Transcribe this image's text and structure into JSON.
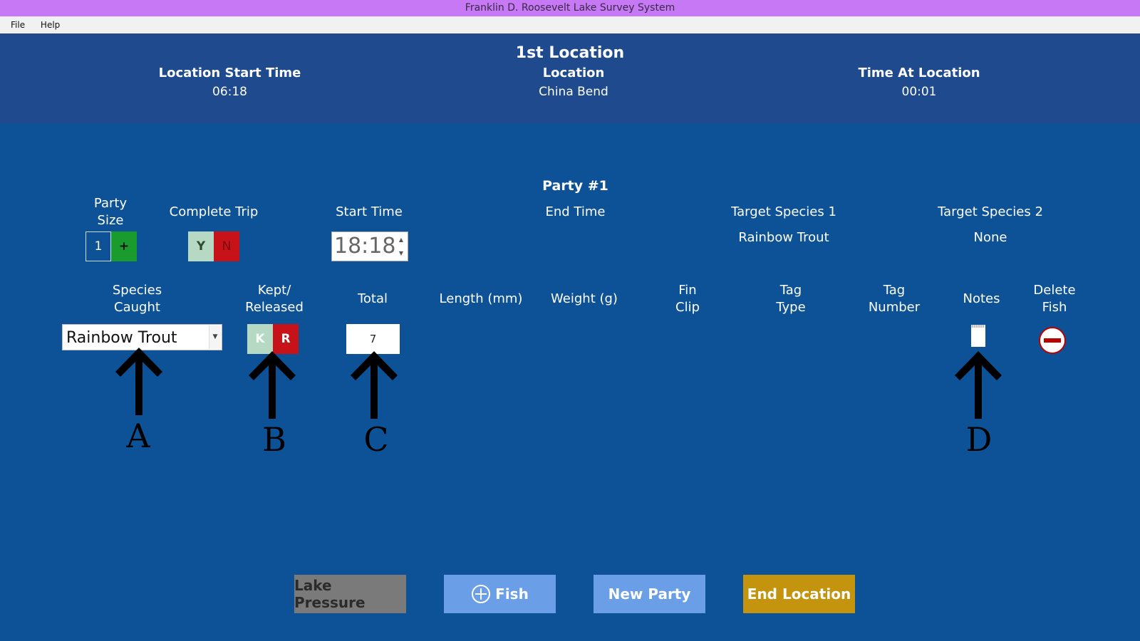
{
  "window": {
    "title": "Franklin D. Roosevelt Lake Survey System"
  },
  "menu": {
    "file": "File",
    "help": "Help"
  },
  "header": {
    "title": "1st Location",
    "start_label": "Location Start Time",
    "start_value": "06:18",
    "location_label": "Location",
    "location_value": "China Bend",
    "time_label": "Time At Location",
    "time_value": "00:01"
  },
  "party": {
    "title": "Party #1",
    "size_label_1": "Party",
    "size_label_2": "Size",
    "size_value": "1",
    "size_plus": "+",
    "complete_trip_label": "Complete Trip",
    "yes": "Y",
    "no": "N",
    "start_time_label": "Start Time",
    "start_time_value": "18:18",
    "end_time_label": "End Time",
    "target1_label": "Target Species 1",
    "target1_value": "Rainbow Trout",
    "target2_label": "Target Species 2",
    "target2_value": "None"
  },
  "fish_table": {
    "col_species_1": "Species",
    "col_species_2": "Caught",
    "col_kept_1": "Kept/",
    "col_kept_2": "Released",
    "col_total": "Total",
    "col_length": "Length (mm)",
    "col_weight": "Weight (g)",
    "col_fin_1": "Fin",
    "col_fin_2": "Clip",
    "col_tagtype_1": "Tag",
    "col_tagtype_2": "Type",
    "col_tagnum_1": "Tag",
    "col_tagnum_2": "Number",
    "col_notes": "Notes",
    "col_delete_1": "Delete",
    "col_delete_2": "Fish",
    "row": {
      "species": "Rainbow Trout",
      "kept": "K",
      "released": "R",
      "total": "7"
    }
  },
  "annotations": {
    "a": "A",
    "b": "B",
    "c": "C",
    "d": "D"
  },
  "buttons": {
    "lake_pressure": "Lake Pressure",
    "add_fish": "Fish",
    "new_party": "New Party",
    "end_location": "End Location"
  },
  "colors": {
    "background": "#0d5296",
    "header": "#1f4a8e",
    "titlebar": "#c678f5",
    "green": "#1a9b2e",
    "red": "#c8121a",
    "light_green": "#b6d9c3",
    "light_blue_button": "#6a9fe8",
    "gray_button": "#7a7a7a",
    "gold_button": "#c4940e"
  },
  "icons": {
    "dropdown": "caret-down-icon",
    "spin_up": "caret-up-icon",
    "spin_down": "caret-down-icon",
    "notes": "notepad-icon",
    "delete": "minus-circle-icon",
    "add_fish": "plus-circle-icon",
    "annotation_arrow": "up-arrow-icon"
  }
}
